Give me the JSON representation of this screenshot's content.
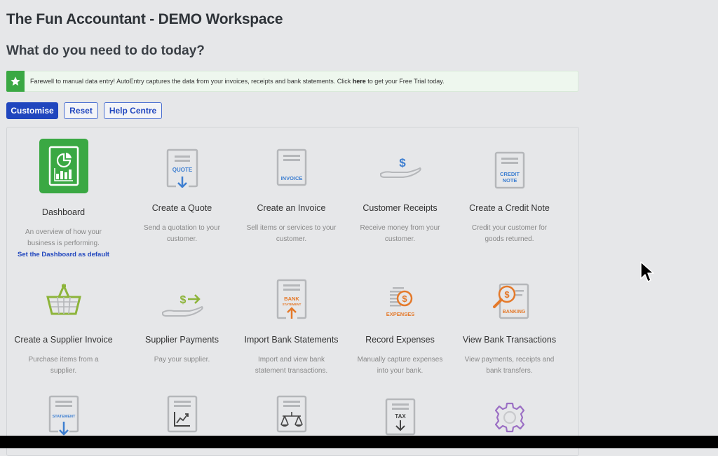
{
  "header": {
    "title": "The Fun Accountant - DEMO Workspace",
    "subtitle": "What do you need to do today?"
  },
  "banner": {
    "icon": "star-icon",
    "text_before": "Farewell to manual data entry! AutoEntry captures the data from your invoices, receipts and bank statements. Click ",
    "link": "here",
    "text_after": " to get your Free Trial today.",
    "accent": "#3aa843"
  },
  "toolbar": {
    "customise": "Customise",
    "reset": "Reset",
    "help": "Help Centre",
    "primary_color": "#2046be"
  },
  "tiles": [
    {
      "name": "Dashboard",
      "desc": "An overview of how your business is performing.",
      "link": "Set the Dashboard as default",
      "icon": "dashboard-icon"
    },
    {
      "name": "Create a Quote",
      "desc": "Send a quotation to your customer.",
      "icon": "quote-icon",
      "icon_label": "QUOTE"
    },
    {
      "name": "Create an Invoice",
      "desc": "Sell items or services to your customer.",
      "icon": "invoice-icon",
      "icon_label": "INVOICE"
    },
    {
      "name": "Customer Receipts",
      "desc": "Receive money from your customer.",
      "icon": "receipt-hand-icon",
      "icon_label": "$"
    },
    {
      "name": "Create a Credit Note",
      "desc": "Credit your customer for goods returned.",
      "icon": "credit-note-icon",
      "icon_label": "CREDIT NOTE"
    },
    {
      "name": "Create a Supplier Invoice",
      "desc": "Purchase items from a supplier.",
      "icon": "basket-icon"
    },
    {
      "name": "Supplier Payments",
      "desc": "Pay your supplier.",
      "icon": "payment-hand-icon",
      "icon_label": "$→"
    },
    {
      "name": "Import Bank Statements",
      "desc": "Import and view bank statement transactions.",
      "icon": "bank-statement-icon",
      "icon_label": "BANK",
      "icon_sublabel": "STATEMENT"
    },
    {
      "name": "Record Expenses",
      "desc": "Manually capture expenses into your bank.",
      "icon": "expenses-icon",
      "icon_label": "EXPENSES"
    },
    {
      "name": "View Bank Transactions",
      "desc": "View payments, receipts and bank transfers.",
      "icon": "banking-icon",
      "icon_label": "BANKING"
    },
    {
      "icon": "statement-icon",
      "icon_label": "STATEMENT"
    },
    {
      "icon": "report-chart-icon"
    },
    {
      "icon": "balance-scale-icon"
    },
    {
      "icon": "tax-icon",
      "icon_label": "TAX"
    },
    {
      "icon": "settings-gear-icon"
    }
  ]
}
